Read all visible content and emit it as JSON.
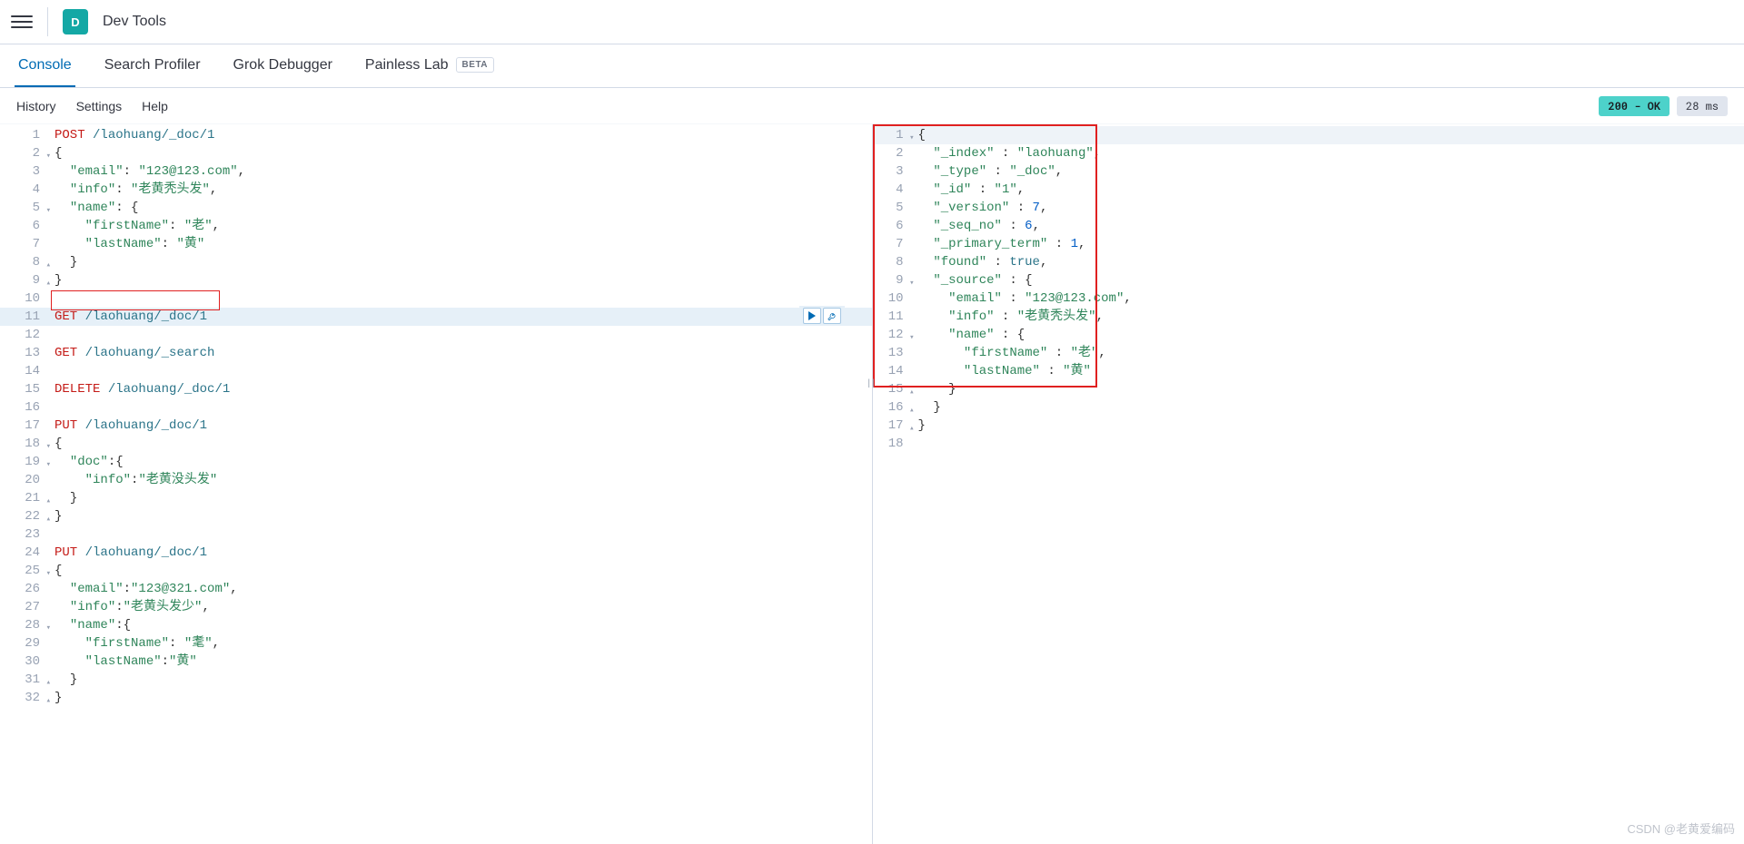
{
  "header": {
    "app_icon_letter": "D",
    "app_title": "Dev Tools"
  },
  "tabs": [
    {
      "label": "Console",
      "active": true
    },
    {
      "label": "Search Profiler",
      "active": false
    },
    {
      "label": "Grok Debugger",
      "active": false
    },
    {
      "label": "Painless Lab",
      "active": false,
      "badge": "BETA"
    }
  ],
  "subnav": {
    "history": "History",
    "settings": "Settings",
    "help": "Help"
  },
  "status": {
    "code": "200 - OK",
    "time": "28 ms"
  },
  "request": {
    "highlighted_line": 11,
    "lines": [
      {
        "n": 1,
        "tokens": [
          [
            "method",
            "POST"
          ],
          [
            "space",
            " "
          ],
          [
            "path",
            "/laohuang/_doc/1"
          ]
        ]
      },
      {
        "n": 2,
        "fold": true,
        "tokens": [
          [
            "brace",
            "{"
          ]
        ]
      },
      {
        "n": 3,
        "tokens": [
          [
            "indent",
            "  "
          ],
          [
            "key",
            "\"email\""
          ],
          [
            "punc",
            ": "
          ],
          [
            "str",
            "\"123@123.com\""
          ],
          [
            "punc",
            ","
          ]
        ]
      },
      {
        "n": 4,
        "tokens": [
          [
            "indent",
            "  "
          ],
          [
            "key",
            "\"info\""
          ],
          [
            "punc",
            ": "
          ],
          [
            "str",
            "\"老黄秃头发\""
          ],
          [
            "punc",
            ","
          ]
        ]
      },
      {
        "n": 5,
        "fold": true,
        "tokens": [
          [
            "indent",
            "  "
          ],
          [
            "key",
            "\"name\""
          ],
          [
            "punc",
            ": "
          ],
          [
            "brace",
            "{"
          ]
        ]
      },
      {
        "n": 6,
        "tokens": [
          [
            "indent",
            "    "
          ],
          [
            "key",
            "\"firstName\""
          ],
          [
            "punc",
            ": "
          ],
          [
            "str",
            "\"老\""
          ],
          [
            "punc",
            ","
          ]
        ]
      },
      {
        "n": 7,
        "tokens": [
          [
            "indent",
            "    "
          ],
          [
            "key",
            "\"lastName\""
          ],
          [
            "punc",
            ": "
          ],
          [
            "str",
            "\"黄\""
          ]
        ]
      },
      {
        "n": 8,
        "foldc": true,
        "tokens": [
          [
            "indent",
            "  "
          ],
          [
            "brace",
            "}"
          ]
        ]
      },
      {
        "n": 9,
        "foldc": true,
        "tokens": [
          [
            "brace",
            "}"
          ]
        ]
      },
      {
        "n": 10,
        "tokens": []
      },
      {
        "n": 11,
        "hl": true,
        "tokens": [
          [
            "method",
            "GET"
          ],
          [
            "space",
            " "
          ],
          [
            "path",
            "/laohuang/_doc/1"
          ]
        ]
      },
      {
        "n": 12,
        "tokens": []
      },
      {
        "n": 13,
        "tokens": [
          [
            "method",
            "GET"
          ],
          [
            "space",
            " "
          ],
          [
            "path",
            "/laohuang/_search"
          ]
        ]
      },
      {
        "n": 14,
        "tokens": []
      },
      {
        "n": 15,
        "tokens": [
          [
            "method",
            "DELETE"
          ],
          [
            "space",
            " "
          ],
          [
            "path",
            "/laohuang/_doc/1"
          ]
        ]
      },
      {
        "n": 16,
        "tokens": []
      },
      {
        "n": 17,
        "tokens": [
          [
            "method",
            "PUT"
          ],
          [
            "space",
            " "
          ],
          [
            "path",
            "/laohuang/_doc/1"
          ]
        ]
      },
      {
        "n": 18,
        "fold": true,
        "tokens": [
          [
            "brace",
            "{"
          ]
        ]
      },
      {
        "n": 19,
        "fold": true,
        "tokens": [
          [
            "indent",
            "  "
          ],
          [
            "key",
            "\"doc\""
          ],
          [
            "punc",
            ":"
          ],
          [
            "brace",
            "{"
          ]
        ]
      },
      {
        "n": 20,
        "tokens": [
          [
            "indent",
            "    "
          ],
          [
            "key",
            "\"info\""
          ],
          [
            "punc",
            ":"
          ],
          [
            "str",
            "\"老黄没头发\""
          ]
        ]
      },
      {
        "n": 21,
        "foldc": true,
        "tokens": [
          [
            "indent",
            "  "
          ],
          [
            "brace",
            "}"
          ]
        ]
      },
      {
        "n": 22,
        "foldc": true,
        "tokens": [
          [
            "brace",
            "}"
          ]
        ]
      },
      {
        "n": 23,
        "tokens": []
      },
      {
        "n": 24,
        "tokens": [
          [
            "method",
            "PUT"
          ],
          [
            "space",
            " "
          ],
          [
            "path",
            "/laohuang/_doc/1"
          ]
        ]
      },
      {
        "n": 25,
        "fold": true,
        "tokens": [
          [
            "brace",
            "{"
          ]
        ]
      },
      {
        "n": 26,
        "tokens": [
          [
            "indent",
            "  "
          ],
          [
            "key",
            "\"email\""
          ],
          [
            "punc",
            ":"
          ],
          [
            "str",
            "\"123@321.com\""
          ],
          [
            "punc",
            ","
          ]
        ]
      },
      {
        "n": 27,
        "tokens": [
          [
            "indent",
            "  "
          ],
          [
            "key",
            "\"info\""
          ],
          [
            "punc",
            ":"
          ],
          [
            "str",
            "\"老黄头发少\""
          ],
          [
            "punc",
            ","
          ]
        ]
      },
      {
        "n": 28,
        "fold": true,
        "tokens": [
          [
            "indent",
            "  "
          ],
          [
            "key",
            "\"name\""
          ],
          [
            "punc",
            ":"
          ],
          [
            "brace",
            "{"
          ]
        ]
      },
      {
        "n": 29,
        "tokens": [
          [
            "indent",
            "    "
          ],
          [
            "key",
            "\"firstName\""
          ],
          [
            "punc",
            ": "
          ],
          [
            "str",
            "\"耄\""
          ],
          [
            "punc",
            ","
          ]
        ]
      },
      {
        "n": 30,
        "tokens": [
          [
            "indent",
            "    "
          ],
          [
            "key",
            "\"lastName\""
          ],
          [
            "punc",
            ":"
          ],
          [
            "str",
            "\"黄\""
          ]
        ]
      },
      {
        "n": 31,
        "foldc": true,
        "tokens": [
          [
            "indent",
            "  "
          ],
          [
            "brace",
            "}"
          ]
        ]
      },
      {
        "n": 32,
        "foldc": true,
        "tokens": [
          [
            "brace",
            "}"
          ]
        ]
      }
    ]
  },
  "response": {
    "lines": [
      {
        "n": 1,
        "fold": true,
        "tokens": [
          [
            "brace",
            "{"
          ]
        ]
      },
      {
        "n": 2,
        "tokens": [
          [
            "indent",
            "  "
          ],
          [
            "key",
            "\"_index\""
          ],
          [
            "punc",
            " : "
          ],
          [
            "str",
            "\"laohuang\""
          ],
          [
            "punc",
            ","
          ]
        ]
      },
      {
        "n": 3,
        "tokens": [
          [
            "indent",
            "  "
          ],
          [
            "key",
            "\"_type\""
          ],
          [
            "punc",
            " : "
          ],
          [
            "str",
            "\"_doc\""
          ],
          [
            "punc",
            ","
          ]
        ]
      },
      {
        "n": 4,
        "tokens": [
          [
            "indent",
            "  "
          ],
          [
            "key",
            "\"_id\""
          ],
          [
            "punc",
            " : "
          ],
          [
            "str",
            "\"1\""
          ],
          [
            "punc",
            ","
          ]
        ]
      },
      {
        "n": 5,
        "tokens": [
          [
            "indent",
            "  "
          ],
          [
            "key",
            "\"_version\""
          ],
          [
            "punc",
            " : "
          ],
          [
            "num",
            "7"
          ],
          [
            "punc",
            ","
          ]
        ]
      },
      {
        "n": 6,
        "tokens": [
          [
            "indent",
            "  "
          ],
          [
            "key",
            "\"_seq_no\""
          ],
          [
            "punc",
            " : "
          ],
          [
            "num",
            "6"
          ],
          [
            "punc",
            ","
          ]
        ]
      },
      {
        "n": 7,
        "tokens": [
          [
            "indent",
            "  "
          ],
          [
            "key",
            "\"_primary_term\""
          ],
          [
            "punc",
            " : "
          ],
          [
            "num",
            "1"
          ],
          [
            "punc",
            ","
          ]
        ]
      },
      {
        "n": 8,
        "tokens": [
          [
            "indent",
            "  "
          ],
          [
            "key",
            "\"found\""
          ],
          [
            "punc",
            " : "
          ],
          [
            "kw",
            "true"
          ],
          [
            "punc",
            ","
          ]
        ]
      },
      {
        "n": 9,
        "fold": true,
        "tokens": [
          [
            "indent",
            "  "
          ],
          [
            "key",
            "\"_source\""
          ],
          [
            "punc",
            " : "
          ],
          [
            "brace",
            "{"
          ]
        ]
      },
      {
        "n": 10,
        "tokens": [
          [
            "indent",
            "    "
          ],
          [
            "key",
            "\"email\""
          ],
          [
            "punc",
            " : "
          ],
          [
            "str",
            "\"123@123.com\""
          ],
          [
            "punc",
            ","
          ]
        ]
      },
      {
        "n": 11,
        "tokens": [
          [
            "indent",
            "    "
          ],
          [
            "key",
            "\"info\""
          ],
          [
            "punc",
            " : "
          ],
          [
            "str",
            "\"老黄秃头发\""
          ],
          [
            "punc",
            ","
          ]
        ]
      },
      {
        "n": 12,
        "fold": true,
        "tokens": [
          [
            "indent",
            "    "
          ],
          [
            "key",
            "\"name\""
          ],
          [
            "punc",
            " : "
          ],
          [
            "brace",
            "{"
          ]
        ]
      },
      {
        "n": 13,
        "tokens": [
          [
            "indent",
            "      "
          ],
          [
            "key",
            "\"firstName\""
          ],
          [
            "punc",
            " : "
          ],
          [
            "str",
            "\"老\""
          ],
          [
            "punc",
            ","
          ]
        ]
      },
      {
        "n": 14,
        "tokens": [
          [
            "indent",
            "      "
          ],
          [
            "key",
            "\"lastName\""
          ],
          [
            "punc",
            " : "
          ],
          [
            "str",
            "\"黄\""
          ]
        ]
      },
      {
        "n": 15,
        "foldc": true,
        "tokens": [
          [
            "indent",
            "    "
          ],
          [
            "brace",
            "}"
          ]
        ]
      },
      {
        "n": 16,
        "foldc": true,
        "tokens": [
          [
            "indent",
            "  "
          ],
          [
            "brace",
            "}"
          ]
        ]
      },
      {
        "n": 17,
        "foldc": true,
        "tokens": [
          [
            "brace",
            "}"
          ]
        ]
      },
      {
        "n": 18,
        "tokens": []
      }
    ]
  },
  "watermark": "CSDN @老黄爱编码"
}
